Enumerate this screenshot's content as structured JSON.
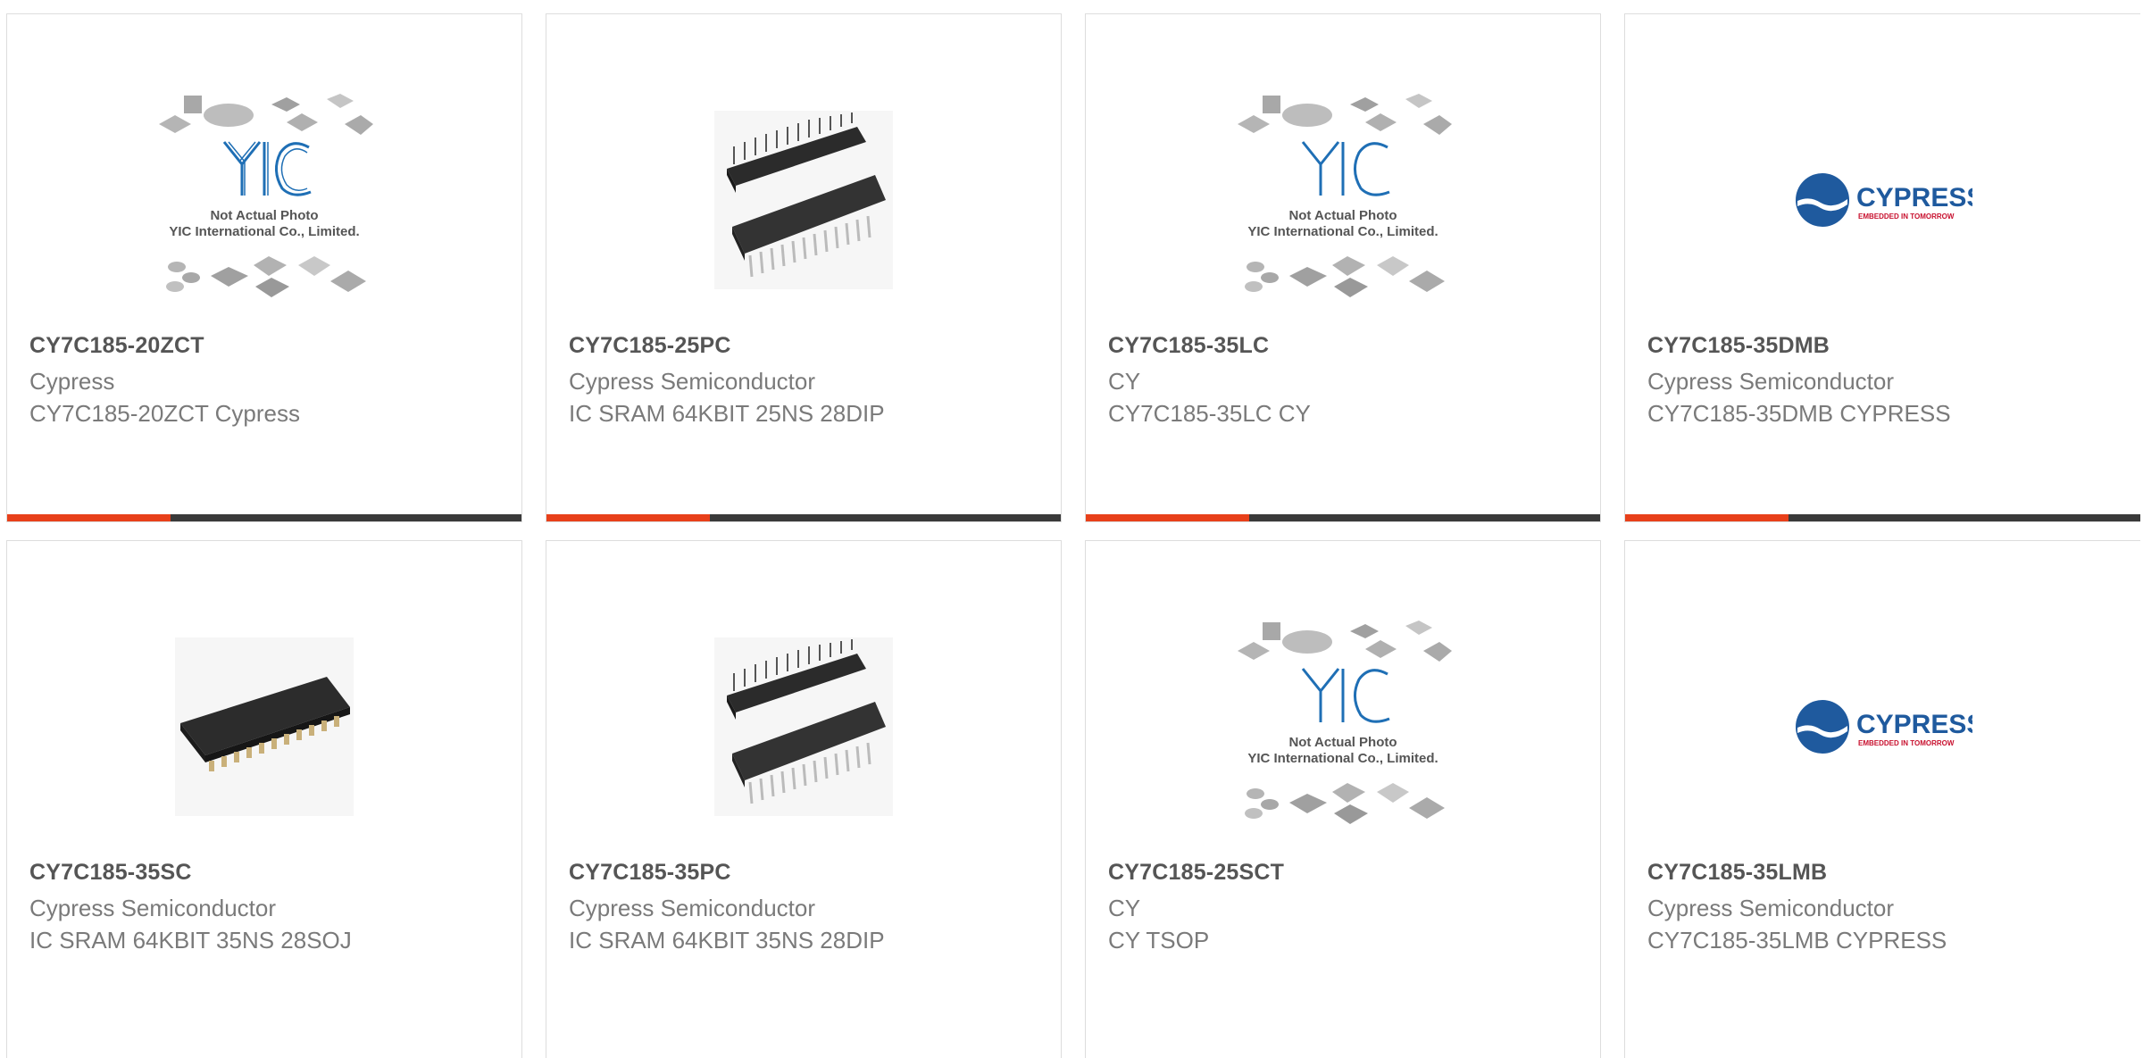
{
  "products": [
    {
      "part": "CY7C185-20ZCT",
      "manufacturer": "Cypress",
      "description": "CY7C185-20ZCT Cypress",
      "image": "yic-placeholder-icon"
    },
    {
      "part": "CY7C185-25PC",
      "manufacturer": "Cypress Semiconductor",
      "description": "IC SRAM 64KBIT 25NS 28DIP",
      "image": "dip-chip-icon"
    },
    {
      "part": "CY7C185-35LC",
      "manufacturer": "CY",
      "description": "CY7C185-35LC CY",
      "image": "yic-placeholder-icon"
    },
    {
      "part": "CY7C185-35DMB",
      "manufacturer": "Cypress Semiconductor",
      "description": "CY7C185-35DMB CYPRESS",
      "image": "cypress-logo-icon"
    },
    {
      "part": "CY7C185-35SC",
      "manufacturer": "Cypress Semiconductor",
      "description": "IC SRAM 64KBIT 35NS 28SOJ",
      "image": "soj-chip-icon"
    },
    {
      "part": "CY7C185-35PC",
      "manufacturer": "Cypress Semiconductor",
      "description": "IC SRAM 64KBIT 35NS 28DIP",
      "image": "dip-chip-icon"
    },
    {
      "part": "CY7C185-25SCT",
      "manufacturer": "CY",
      "description": "CY TSOP",
      "image": "yic-placeholder-icon"
    },
    {
      "part": "CY7C185-35LMB",
      "manufacturer": "Cypress Semiconductor",
      "description": "CY7C185-35LMB CYPRESS",
      "image": "cypress-logo-icon"
    }
  ],
  "placeholder": {
    "line1": "Not Actual Photo",
    "line2": "YIC International Co., Limited.",
    "logo": "YIC"
  },
  "cypress_logo": {
    "name": "CYPRESS",
    "tagline": "EMBEDDED IN TOMORROW"
  },
  "colors": {
    "accent": "#e8401a",
    "bar": "#3a3a3a",
    "yic_blue": "#1f6fb5",
    "cypress_blue": "#1f5a9e",
    "cypress_red": "#c8102e"
  }
}
